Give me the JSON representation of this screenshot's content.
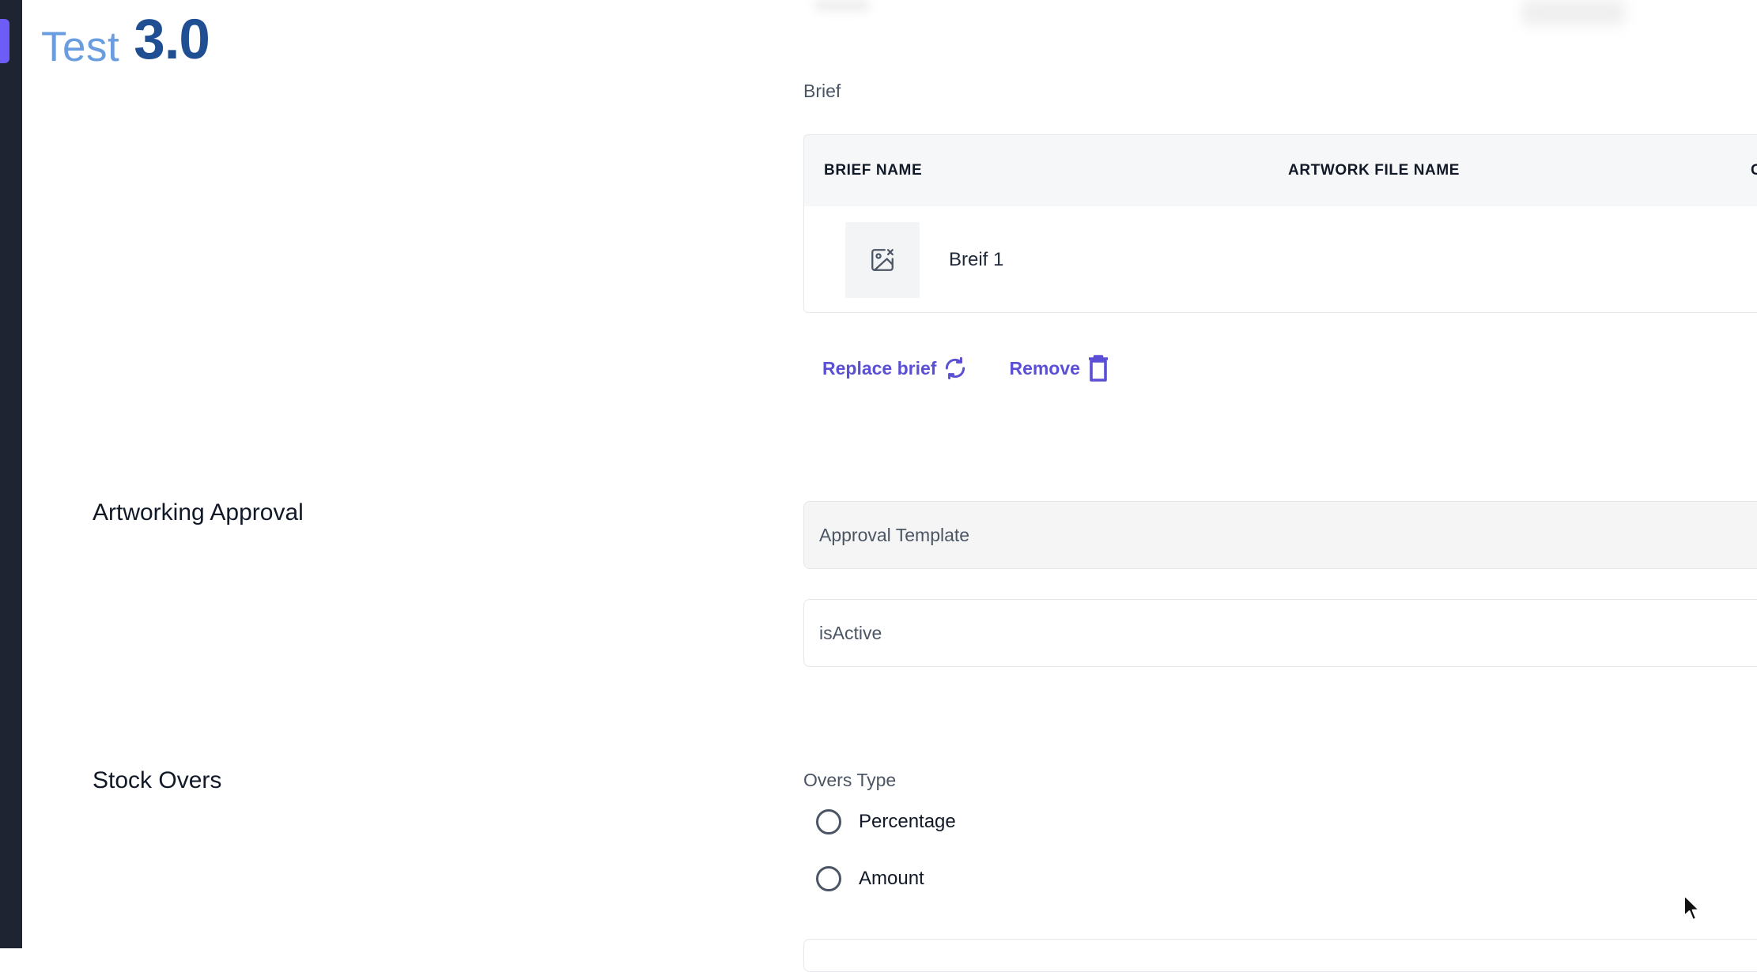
{
  "app": {
    "logo_word": "Test",
    "logo_version": "3.0"
  },
  "brief_section": {
    "label": "Brief",
    "table": {
      "columns": [
        "BRIEF NAME",
        "ARTWORK FILE NAME",
        "C"
      ],
      "rows": [
        {
          "brief_name": "Breif 1",
          "thumbnail_icon": "image-broken-icon"
        }
      ]
    },
    "actions": {
      "replace_label": "Replace brief",
      "replace_icon": "refresh-icon",
      "remove_label": "Remove",
      "remove_icon": "trash-icon"
    }
  },
  "artworking_approval": {
    "heading": "Artworking Approval",
    "approval_template_placeholder": "Approval Template",
    "is_active_label": "isActive"
  },
  "stock_overs": {
    "heading": "Stock Overs",
    "overs_type_label": "Overs Type",
    "options": [
      "Percentage",
      "Amount"
    ]
  },
  "colors": {
    "accent": "#5b4fd6",
    "rail": "#1f2433",
    "rail_accent": "#6d5cf6"
  }
}
